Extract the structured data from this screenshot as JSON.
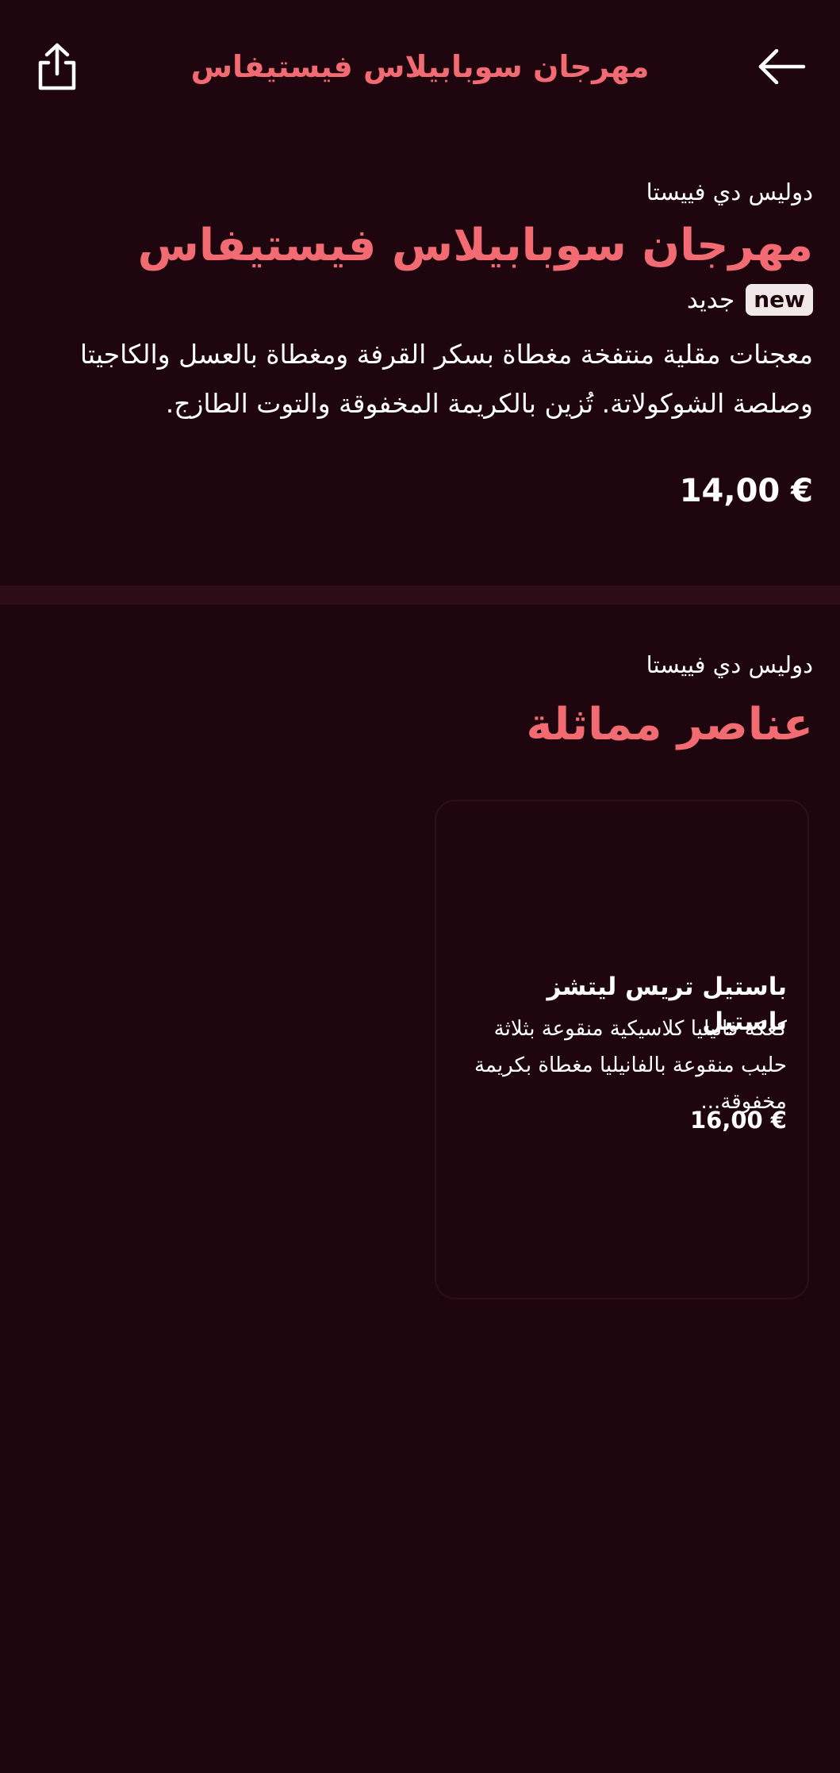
{
  "header": {
    "title": "مهرجان سوبابيلاس فيستيفاس",
    "share_icon": "share-icon",
    "back_icon": "arrow-left-icon"
  },
  "product": {
    "brand": "دوليس دي فييستا",
    "title": "مهرجان سوبابيلاس فيستيفاس",
    "badge": "new",
    "badge_label": "جديد",
    "description": "معجنات مقلية منتفخة مغطاة بسكر القرفة ومغطاة بالعسل والكاجيتا وصلصة الشوكولاتة. تُزين بالكريمة المخفوقة والتوت الطازج.",
    "price": "14,00 €"
  },
  "similar": {
    "brand": "دوليس دي فييستا",
    "title": "عناصر مماثلة",
    "items": [
      {
        "title": "باستيل تريس ليتشز باستيل",
        "description": "كعكة فانيليا كلاسيكية منقوعة بثلاثة حليب منقوعة بالفانيليا مغطاة بكريمة مخفوقة...",
        "price": "16,00 €"
      }
    ]
  },
  "colors": {
    "background": "#1f060e",
    "accent": "#f26a72",
    "divider": "#2c0c16",
    "badge_bg": "#f1e8ea"
  }
}
